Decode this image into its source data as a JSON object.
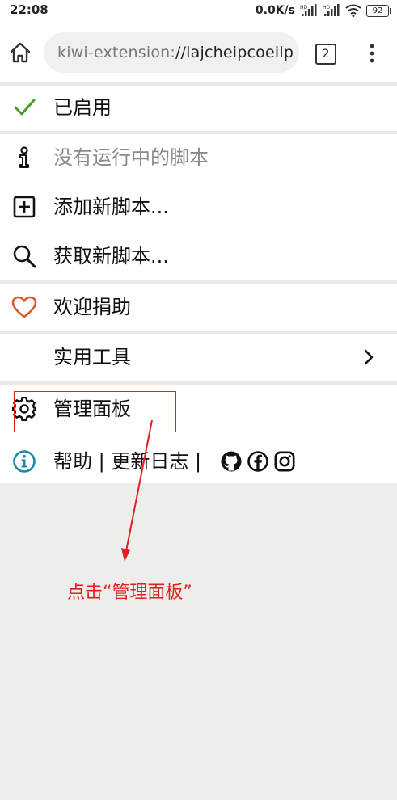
{
  "status_bar": {
    "time": "22:08",
    "net_speed": "0.0K/s",
    "battery": "92"
  },
  "toolbar": {
    "url_scheme": "kiwi-extension:",
    "url_rest": "//lajcheipcoeilp",
    "tab_count": "2"
  },
  "menu": {
    "enabled_label": "已启用",
    "no_scripts_label": "没有运行中的脚本",
    "add_script_label": "添加新脚本...",
    "get_scripts_label": "获取新脚本...",
    "donate_label": "欢迎捐助",
    "utilities_label": "实用工具",
    "dashboard_label": "管理面板",
    "help_label": "帮助",
    "help_divider_1": " | ",
    "changelog_label": "更新日志",
    "help_divider_2": " |"
  },
  "annotation": {
    "text": "点击“管理面板”"
  },
  "colors": {
    "check_green": "#4a9a2e",
    "heart_orange": "#d85a2b",
    "info_teal": "#1a8aa8",
    "annotation_red": "#e02020",
    "page_background": "#ededeb"
  }
}
